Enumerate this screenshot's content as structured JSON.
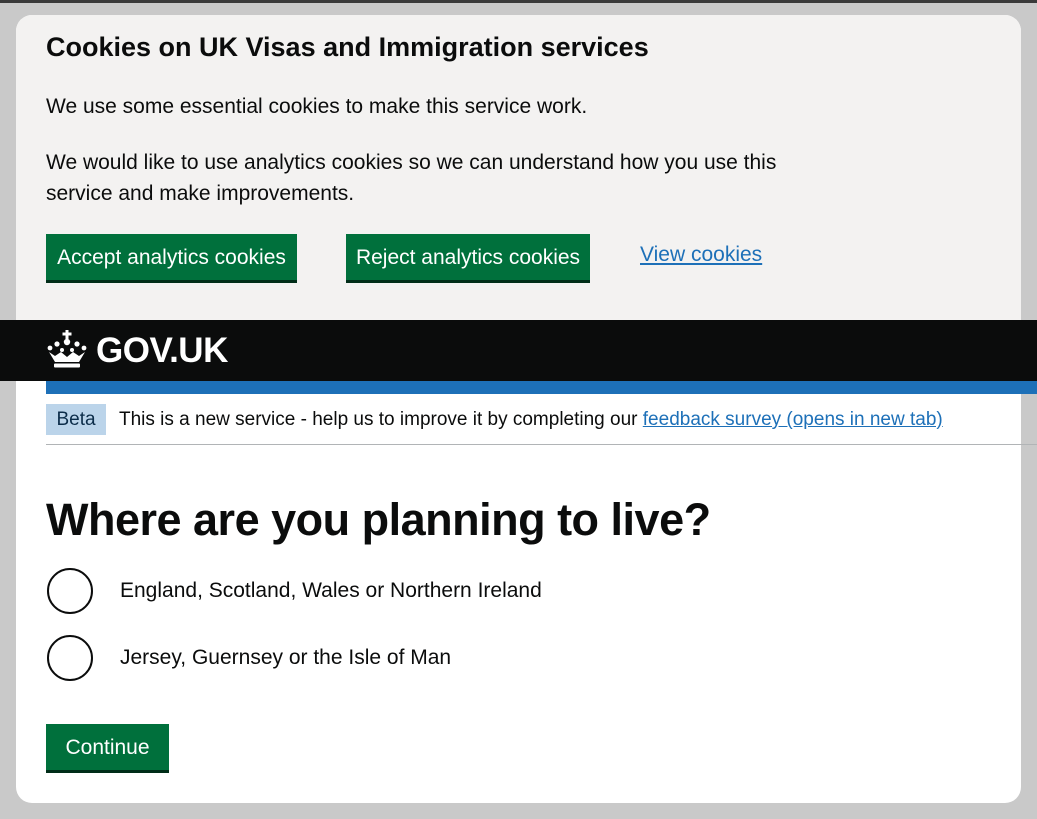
{
  "cookie_banner": {
    "title": "Cookies on UK Visas and Immigration services",
    "paragraph_1": "We use some essential cookies to make this service work.",
    "paragraph_2": "We would like to use analytics cookies so we can understand how you use this service and make improvements.",
    "accept_label": "Accept analytics cookies",
    "reject_label": "Reject analytics cookies",
    "view_label": "View cookies"
  },
  "header": {
    "logo_text": "GOV.UK",
    "logo_icon": "crown-icon"
  },
  "phase_banner": {
    "tag": "Beta",
    "text": "This is a new service - help us to improve it by completing our ",
    "link_text": "feedback survey (opens in new tab)"
  },
  "main": {
    "question": "Where are you planning to live?",
    "options": [
      {
        "label": "England, Scotland, Wales or Northern Ireland"
      },
      {
        "label": "Jersey, Guernsey or the Isle of Man"
      }
    ],
    "continue_label": "Continue"
  },
  "colors": {
    "button_green": "#00703c",
    "link_blue": "#1d70b8",
    "header_black": "#0b0c0c",
    "banner_grey": "#f3f2f1",
    "beta_tag_bg": "#bbd4ea"
  }
}
